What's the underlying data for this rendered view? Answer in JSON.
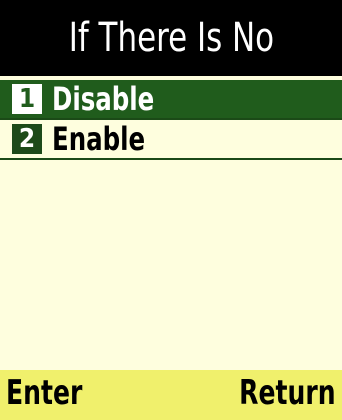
{
  "title": "If There Is No",
  "menu": {
    "items": [
      {
        "number": "1",
        "label": "Disable",
        "selected": true
      },
      {
        "number": "2",
        "label": "Enable",
        "selected": false
      }
    ]
  },
  "softkeys": {
    "left": "Enter",
    "right": "Return"
  },
  "colors": {
    "title_bg": "#000000",
    "selected_bg": "#205c1c",
    "screen_bg": "#fefede",
    "softkey_bg": "#f0f06c"
  }
}
